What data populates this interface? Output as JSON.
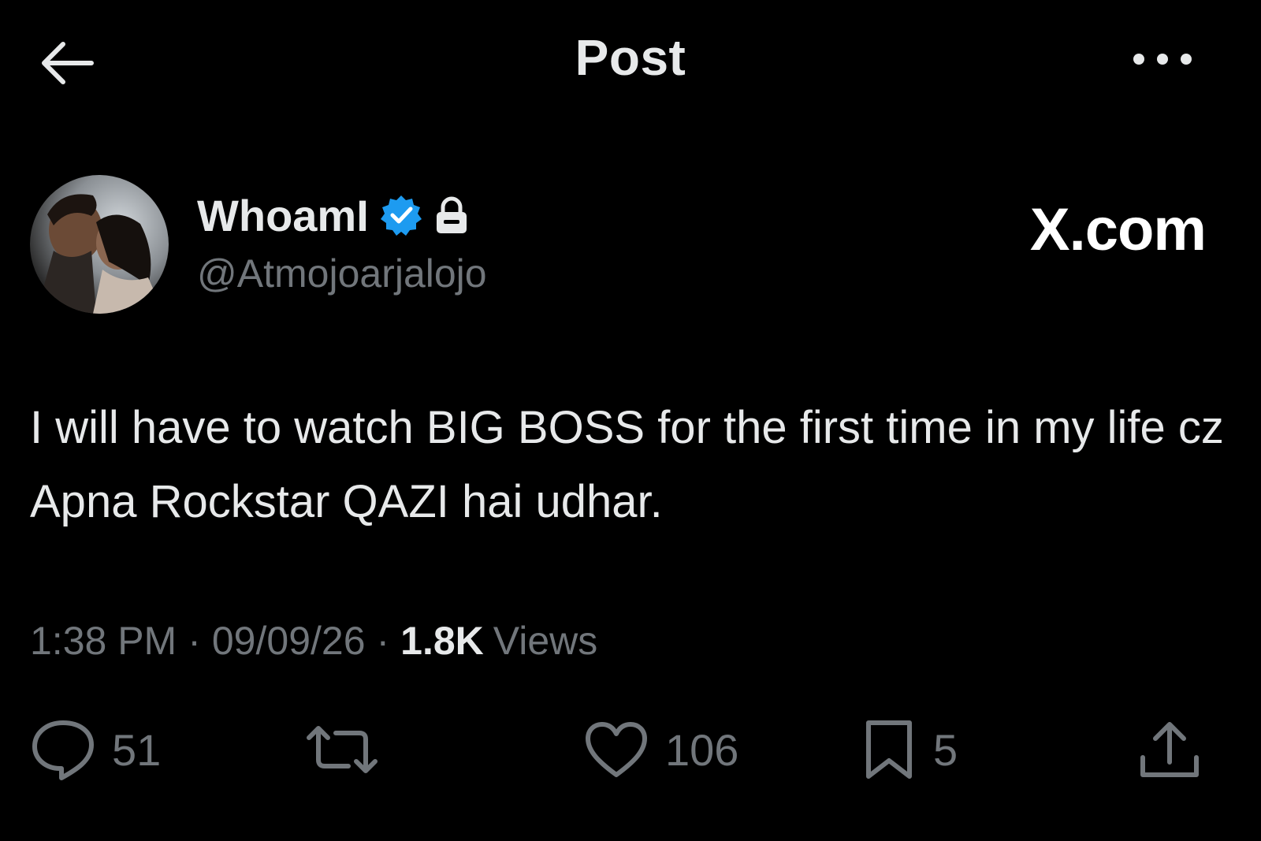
{
  "header": {
    "title": "Post",
    "back_icon": "arrow-left-icon",
    "more_icon": "more-horizontal-icon"
  },
  "author": {
    "display_name": "WhoamI",
    "handle": "@Atmojoarjalojo",
    "verified_icon": "verified-badge-icon",
    "protected_icon": "lock-icon",
    "verified_color": "#1d9bf0"
  },
  "brand": {
    "watermark": "X.com"
  },
  "post": {
    "text": "I will have to watch BIG BOSS for the first time in my life cz Apna Rockstar QAZI hai udhar."
  },
  "meta": {
    "time": "1:38 PM",
    "separator": "·",
    "date": "09/09/26",
    "views_count": "1.8K",
    "views_label": "Views"
  },
  "actions": {
    "reply": {
      "icon": "reply-icon",
      "count": "51"
    },
    "repost": {
      "icon": "repost-icon",
      "count": ""
    },
    "like": {
      "icon": "heart-icon",
      "count": "106"
    },
    "bookmark": {
      "icon": "bookmark-icon",
      "count": "5"
    },
    "share": {
      "icon": "share-icon"
    }
  },
  "colors": {
    "background": "#000000",
    "primary_text": "#e7e9ea",
    "secondary_text": "#71767b"
  }
}
